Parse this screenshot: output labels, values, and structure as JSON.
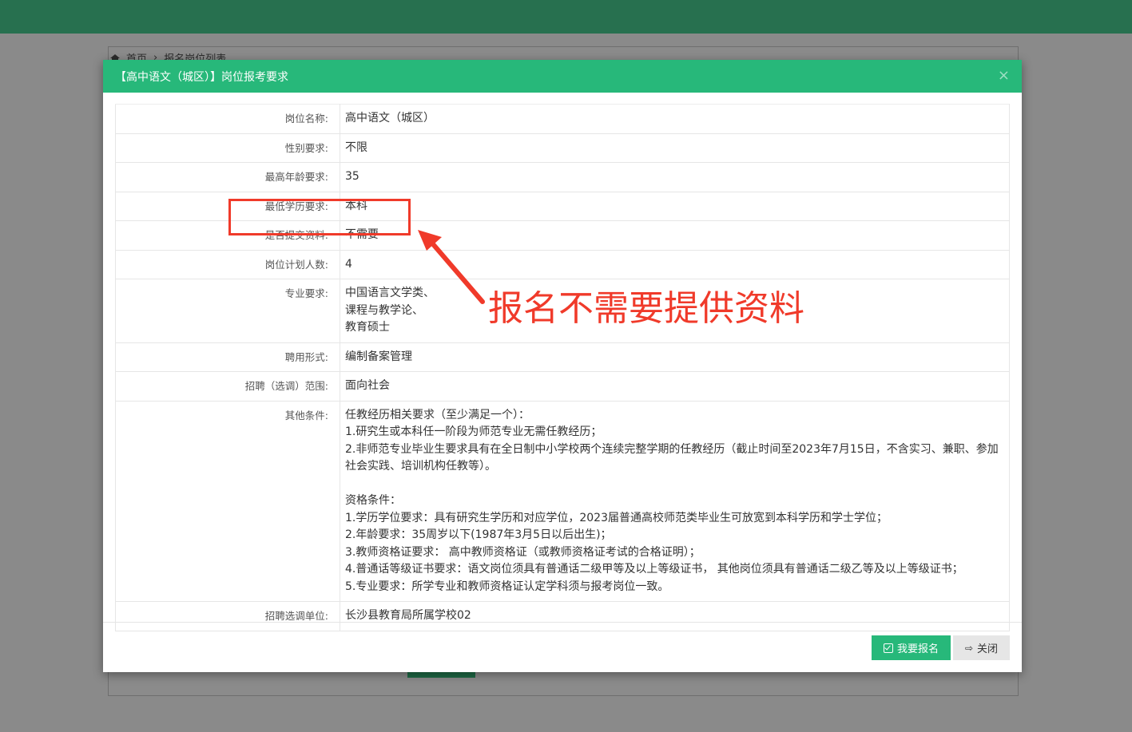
{
  "background": {
    "breadcrumb": {
      "home": "首页",
      "separator": "›",
      "current": "报名岗位列表"
    }
  },
  "modal": {
    "title": "【高中语文（城区）】岗位报考要求",
    "close_symbol": "×",
    "rows": [
      {
        "label": "岗位名称:",
        "value": "高中语文（城区）"
      },
      {
        "label": "性别要求:",
        "value": "不限"
      },
      {
        "label": "最高年龄要求:",
        "value": "35"
      },
      {
        "label": "最低学历要求:",
        "value": "本科"
      },
      {
        "label": "是否提交资料:",
        "value": "不需要"
      },
      {
        "label": "岗位计划人数:",
        "value": "4"
      },
      {
        "label": "专业要求:",
        "value": "中国语言文学类、\n课程与教学论、\n教育硕士"
      },
      {
        "label": "聘用形式:",
        "value": "编制备案管理"
      },
      {
        "label": "招聘（选调）范围:",
        "value": "面向社会"
      },
      {
        "label": "其他条件:",
        "value": "任教经历相关要求（至少满足一个）：\n1.研究生或本科任一阶段为师范专业无需任教经历；\n2.非师范专业毕业生要求具有在全日制中小学校两个连续完整学期的任教经历（截止时间至2023年7月15日，不含实习、兼职、参加社会实践、培训机构任教等）。\n\n资格条件：\n1.学历学位要求：具有研究生学历和对应学位，2023届普通高校师范类毕业生可放宽到本科学历和学士学位；\n2.年龄要求：35周岁以下(1987年3月5日以后出生)；\n3.教师资格证要求： 高中教师资格证（或教师资格证考试的合格证明）；\n4.普通话等级证书要求：语文岗位须具有普通话二级甲等及以上等级证书， 其他岗位须具有普通话二级乙等及以上等级证书；\n5.专业要求：所学专业和教师资格证认定学科须与报考岗位一致。"
      },
      {
        "label": "招聘选调单位:",
        "value": "长沙县教育局所属学校02"
      }
    ],
    "footer": {
      "signup_label": "我要报名",
      "close_label": "关闭"
    }
  },
  "annotation": {
    "text": "报名不需要提供资料",
    "color": "#f03a2a"
  },
  "colors": {
    "topbar": "#27704f",
    "modal_header": "#27b87a",
    "primary_button": "#27b87a"
  }
}
